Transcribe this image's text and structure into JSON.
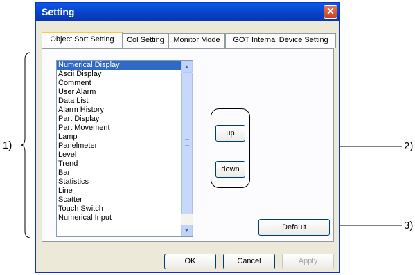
{
  "dialog": {
    "title": "Setting",
    "close_glyph": "✕"
  },
  "tabs": [
    {
      "label": "Object Sort Setting"
    },
    {
      "label": "Col Setting"
    },
    {
      "label": "Monitor Mode"
    },
    {
      "label": "GOT Internal Device Setting"
    }
  ],
  "list": {
    "items": [
      "Numerical Display",
      "Ascii Display",
      "Comment",
      "User Alarm",
      "Data List",
      "Alarm History",
      "Part Display",
      "Part Movement",
      "Lamp",
      "Panelmeter",
      "Level",
      "Trend",
      "Bar",
      "Statistics",
      "Line",
      "Scatter",
      "Touch Switch",
      "Numerical Input"
    ],
    "selected": "Numerical Display",
    "scroll_up_glyph": "▲",
    "scroll_down_glyph": "▼"
  },
  "buttons": {
    "up": "up",
    "down": "down",
    "default": "Default",
    "ok": "OK",
    "cancel": "Cancel",
    "apply": "Apply"
  },
  "annotations": {
    "a1": "1)",
    "a2": "2)",
    "a3": "3)"
  },
  "colors": {
    "title_bar": "#0a5ae6",
    "selection": "#316ac5",
    "dialog_bg": "#ece9d8"
  }
}
